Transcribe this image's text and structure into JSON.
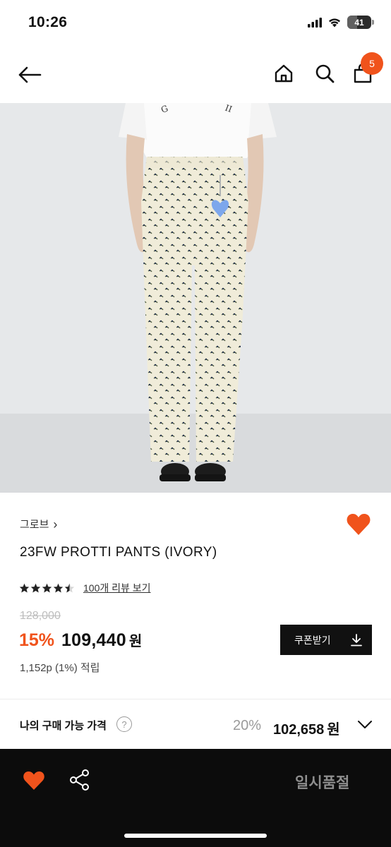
{
  "status_bar": {
    "time": "10:26",
    "battery": "41",
    "battery_level": 0.41,
    "icons": [
      "signal-bars-icon",
      "wifi-icon",
      "battery-icon"
    ]
  },
  "header": {
    "cart_count": "5",
    "icons": [
      "back-arrow-icon",
      "home-icon",
      "search-icon",
      "shopping-bag-icon"
    ]
  },
  "product": {
    "brand": "그로브",
    "brand_chevron": "›",
    "title": "23FW PROTTI PANTS (IVORY)",
    "rating": 4.5,
    "review_link": "100개 리뷰 보기",
    "original_price": "128,000",
    "discount_rate": "15%",
    "sale_price": "109,440",
    "currency": "원",
    "coupon_button": "쿠폰받기",
    "points": "1,152p (1%) 적립",
    "wishlisted": true
  },
  "my_price": {
    "label": "나의 구매 가능 가격",
    "help": "?",
    "discount_rate": "20%",
    "price": "102,658",
    "currency": "원"
  },
  "bottom_bar": {
    "status_label": "일시품절",
    "icons": [
      "heart-icon",
      "share-icon"
    ]
  },
  "colors": {
    "accent": "#f0531c",
    "dark": "#0c0c0c",
    "muted": "#9a9a9a"
  }
}
